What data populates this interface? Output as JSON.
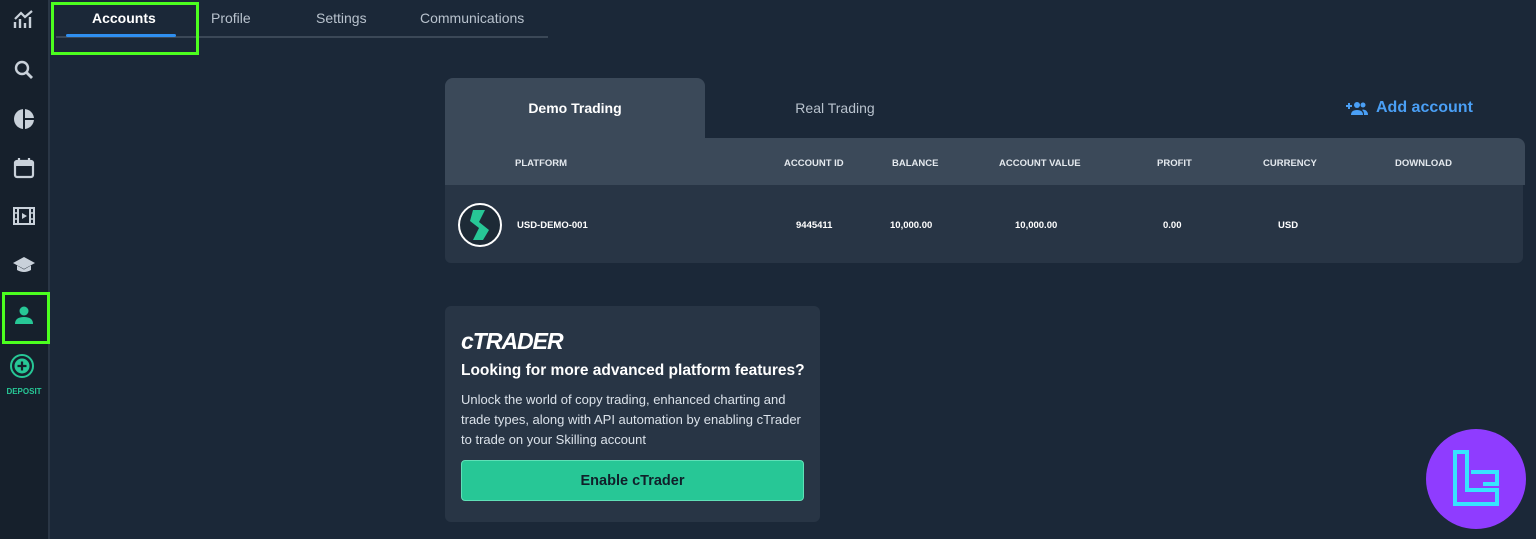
{
  "sidebar": {
    "items": [
      {
        "icon": "chart-trend-icon"
      },
      {
        "icon": "search-icon"
      },
      {
        "icon": "pie-chart-icon"
      },
      {
        "icon": "calendar-icon"
      },
      {
        "icon": "film-icon"
      },
      {
        "icon": "graduation-cap-icon"
      },
      {
        "icon": "user-icon",
        "active": true
      }
    ],
    "deposit_label": "DEPOSIT",
    "accent": "#27c796",
    "highlight": "#4cff1f"
  },
  "tabs": [
    {
      "label": "Accounts",
      "active": true
    },
    {
      "label": "Profile"
    },
    {
      "label": "Settings"
    },
    {
      "label": "Communications"
    }
  ],
  "accounts": {
    "demo_tab": "Demo Trading",
    "real_tab": "Real Trading",
    "add_account": "Add account",
    "columns": [
      "PLATFORM",
      "ACCOUNT ID",
      "BALANCE",
      "ACCOUNT VALUE",
      "PROFIT",
      "CURRENCY",
      "DOWNLOAD"
    ],
    "rows": [
      {
        "platform": "USD-DEMO-001",
        "account_id": "9445411",
        "balance": "10,000.00",
        "account_value": "10,000.00",
        "profit": "0.00",
        "currency": "USD"
      }
    ]
  },
  "promo": {
    "logo": "cTRADER",
    "title": "Looking for more advanced platform features?",
    "text": "Unlock the world of copy trading, enhanced charting and trade types, along with API automation by enabling cTrader to trade on your Skilling account",
    "button": "Enable cTrader"
  },
  "colors": {
    "background": "#1b2838",
    "link": "#4a9ff5",
    "button": "#27c796",
    "watermark": "#8f3cff"
  }
}
